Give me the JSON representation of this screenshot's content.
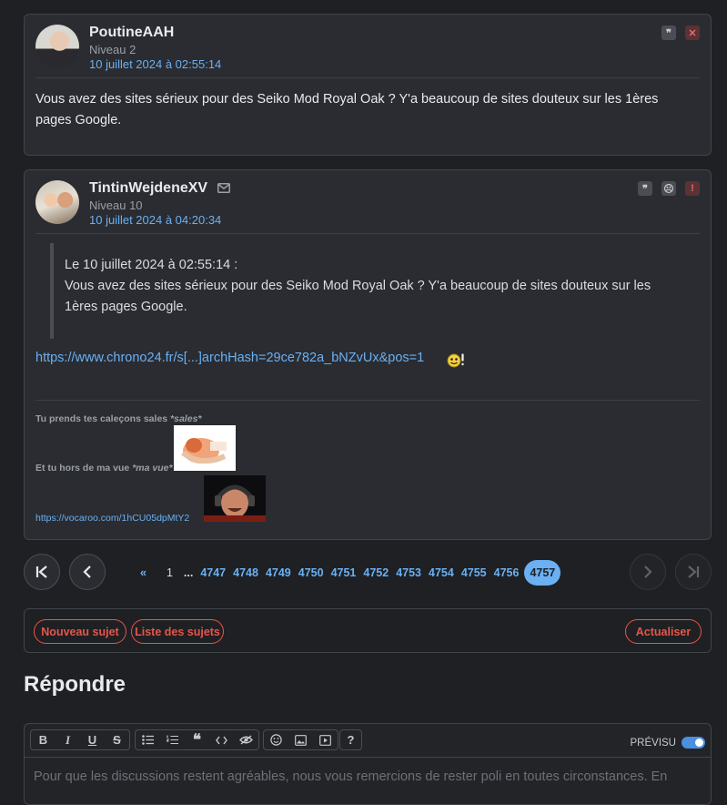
{
  "posts": [
    {
      "username": "PoutineAAH",
      "level": "Niveau 2",
      "date": "10 juillet 2024 à 02:55:14",
      "content": "Vous avez des sites sérieux pour des Seiko Mod Royal Oak ? Y'a beaucoup de sites douteux sur les 1ères pages Google."
    },
    {
      "username": "TintinWejdeneXV",
      "level": "Niveau 10",
      "date": "10 juillet 2024 à 04:20:34",
      "quote_header": "Le 10 juillet 2024 à 02:55:14 :",
      "quote_text": "Vous avez des sites sérieux pour des Seiko Mod Royal Oak ? Y'a beaucoup de sites douteux sur les 1ères pages Google.",
      "link": "https://www.chrono24.fr/s[...]archHash=29ce782a_bNZvUx&pos=1",
      "signature": {
        "line1": "Tu prends tes caleçons sales ",
        "line1_em": "*sales*",
        "line2": "Et tu hors de ma vue ",
        "line2_em": "*ma vue*",
        "link": "https://vocaroo.com/1hCU05dpMtY2"
      }
    }
  ],
  "pagination": {
    "prev_all": "«",
    "first": "1",
    "ellipsis": "...",
    "pages": [
      "4747",
      "4748",
      "4749",
      "4750",
      "4751",
      "4752",
      "4753",
      "4754",
      "4755",
      "4756"
    ],
    "current": "4757"
  },
  "actions": {
    "new_topic": "Nouveau sujet",
    "topic_list": "Liste des sujets",
    "refresh": "Actualiser"
  },
  "reply": {
    "heading": "Répondre",
    "preview_label": "PRÉVISU",
    "placeholder": "Pour que les discussions restent agréables, nous vous remercions de rester poli en toutes circonstances. En"
  },
  "toolbar": {
    "bold": "B",
    "italic": "I",
    "underline": "U",
    "strike": "S",
    "help": "?"
  },
  "colors": {
    "accent_blue": "#6ab0f3",
    "accent_orange": "#e4564a",
    "background": "#1f2023",
    "card": "#2a2c31"
  }
}
